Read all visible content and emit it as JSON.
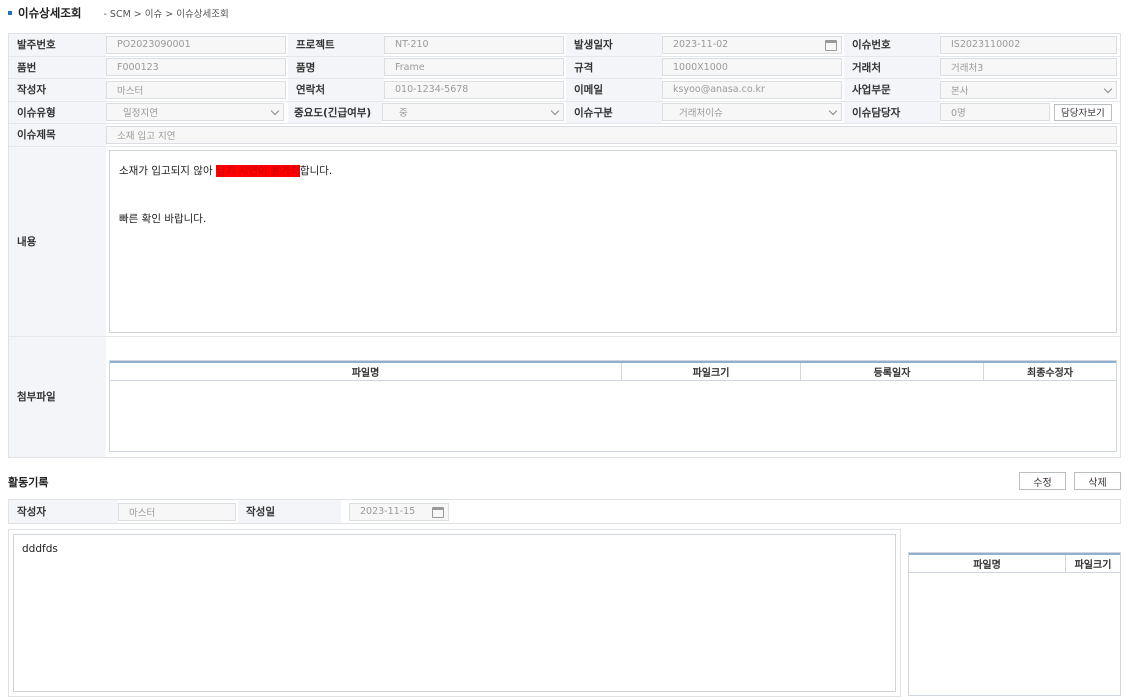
{
  "header": {
    "title": "이슈상세조회",
    "breadcrumb": "- SCM > 이슈 > 이슈상세조회"
  },
  "form": {
    "order_no": {
      "label": "발주번호",
      "value": "PO2023090001"
    },
    "project": {
      "label": "프로젝트",
      "value": "NT-210"
    },
    "occur_date": {
      "label": "발생일자",
      "value": "2023-11-02"
    },
    "issue_no": {
      "label": "이슈번호",
      "value": "IS2023110002"
    },
    "item_no": {
      "label": "품번",
      "value": "F000123"
    },
    "item_name": {
      "label": "품명",
      "value": "Frame"
    },
    "spec": {
      "label": "규격",
      "value": "1000X1000"
    },
    "vendor": {
      "label": "거래처",
      "value": "거래처3"
    },
    "writer": {
      "label": "작성자",
      "value": "마스터"
    },
    "contact": {
      "label": "연락처",
      "value": "010-1234-5678"
    },
    "email": {
      "label": "이메일",
      "value": "ksyoo@anasa.co.kr"
    },
    "division": {
      "label": "사업부문",
      "value": "본사"
    },
    "issue_type": {
      "label": "이슈유형",
      "value": "일정지연"
    },
    "importance": {
      "label": "중요도(긴급여부)",
      "value": "중"
    },
    "issue_category": {
      "label": "이슈구분",
      "value": "거래처이슈"
    },
    "assignee": {
      "label": "이슈담당자",
      "value": "0명",
      "button": "담당자보기"
    },
    "subject": {
      "label": "이슈제목",
      "value": "소재 입고 지연"
    },
    "content": {
      "label": "내용",
      "line1_pre": "소재가 입고되지 않아 ",
      "line1_highlight": "납기 지연이 불가피",
      "line1_post": "합니다.",
      "line2": "빠른 확인 바랍니다."
    },
    "attachments": {
      "label": "첨부파일",
      "columns": [
        "파일명",
        "파일크기",
        "등록일자",
        "최종수정자"
      ]
    }
  },
  "activity": {
    "title": "활동기록",
    "edit_button": "수정",
    "delete_button": "삭제",
    "writer_label": "작성자",
    "writer_value": "마스터",
    "date_label": "작성일",
    "date_value": "2023-11-15",
    "memo": "dddfds",
    "file_columns": [
      "파일명",
      "파일크기"
    ]
  }
}
